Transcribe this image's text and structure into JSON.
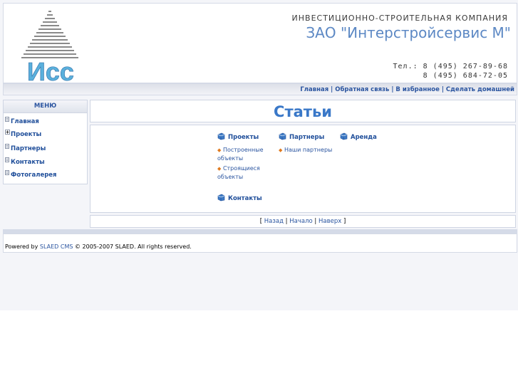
{
  "header": {
    "logo_text": "Исс",
    "company_subtitle": "ИНВЕСТИЦИОННО-СТРОИТЕЛЬНАЯ КОМПАНИЯ",
    "company_name": "ЗАО \"Интерстройсервис М\"",
    "phone1": "Тел.:  8 (495) 267-89-68",
    "phone2": "8 (495) 684-72-05"
  },
  "topnav": {
    "home": "Главная",
    "feedback": "Обратная связь",
    "favorites": "В избранное",
    "make_home": "Сделать домашней",
    "sep": "|"
  },
  "menu": {
    "title": "МЕНЮ",
    "items": [
      {
        "label": "Главная"
      },
      {
        "label": "Проекты"
      },
      {
        "label": "Партнеры"
      },
      {
        "label": "Контакты"
      },
      {
        "label": "Фотогалерея"
      }
    ]
  },
  "page": {
    "title": "Статьи"
  },
  "categories": {
    "projects": {
      "label": "Проекты",
      "subs": [
        "Построенные объекты",
        "Строящиеся объекты"
      ],
      "sub1_line1": "Построенные",
      "sub1_line2": "объекты",
      "sub2_line1": "Строящиеся",
      "sub2_line2": "объекты"
    },
    "partners": {
      "label": "Партнеры",
      "sub1": "Наши партнеры"
    },
    "rent": {
      "label": "Аренда"
    },
    "contacts": {
      "label": "Контакты"
    }
  },
  "pager": {
    "open": "[",
    "back": "Назад",
    "start": "Начало",
    "top": "Наверх",
    "sep": "|",
    "close": "]"
  },
  "footer": {
    "powered": "Powered by",
    "cms": "SLAED CMS",
    "rights": "© 2005-2007 SLAED. All rights reserved."
  },
  "colors": {
    "link": "#2b55a0",
    "title": "#3a78c8",
    "logo": "#5ab0dc",
    "bullet": "#e07a1f"
  }
}
